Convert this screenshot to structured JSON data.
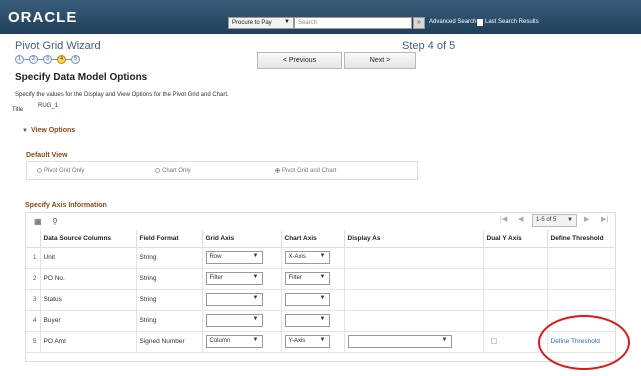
{
  "header": {
    "logo": "ORACLE",
    "scope": "Procure to Pay",
    "search_placeholder": "Search",
    "go": "»",
    "advanced_search": "Advanced Search",
    "last_search": "Last Search Results"
  },
  "wizard": {
    "title": "Pivot Grid Wizard",
    "step_label": "Step 4 of 5",
    "steps": [
      "1",
      "2",
      "3",
      "4",
      "5"
    ],
    "active_step": 4,
    "previous": "< Previous",
    "next": "Next >"
  },
  "page": {
    "title": "Specify Data Model Options",
    "intro": "Specify the values for the Display and View Options for the Pivot Grid and Chart.",
    "title_label": "Title",
    "title_value": "RUG_1"
  },
  "view_options": {
    "label": "View Options",
    "default_view": {
      "label": "Default View",
      "options": [
        "Pivot Grid Only",
        "Chart Only",
        "Pivot Grid and Chart"
      ],
      "selected": "Pivot Grid and Chart"
    }
  },
  "axis": {
    "label": "Specify Axis Information",
    "pager": {
      "first": "|◀",
      "prev": "◀",
      "range": "1-5 of 5",
      "next": "▶",
      "last": "▶|"
    },
    "columns": [
      "Data Source Columns",
      "Field Format",
      "Grid Axis",
      "Chart Axis",
      "Display As",
      "Dual Y Axis",
      "Define Threshold"
    ],
    "rows": [
      {
        "num": "1",
        "column": "Unit",
        "format": "String",
        "grid_axis": "Row",
        "chart_axis": "X-Axis",
        "display_as": "",
        "dual_y": false,
        "threshold": ""
      },
      {
        "num": "2",
        "column": "PO No.",
        "format": "String",
        "grid_axis": "Filter",
        "chart_axis": "Filter",
        "display_as": "",
        "dual_y": false,
        "threshold": ""
      },
      {
        "num": "3",
        "column": "Status",
        "format": "String",
        "grid_axis": "",
        "chart_axis": "",
        "display_as": "",
        "dual_y": false,
        "threshold": ""
      },
      {
        "num": "4",
        "column": "Buyer",
        "format": "String",
        "grid_axis": "",
        "chart_axis": "",
        "display_as": "",
        "dual_y": false,
        "threshold": ""
      },
      {
        "num": "5",
        "column": "PO Amt",
        "format": "Signed Number",
        "grid_axis": "Column",
        "chart_axis": "Y-Axis",
        "display_as": "",
        "dual_y": false,
        "threshold": "Define Threshold"
      }
    ]
  },
  "colors": {
    "header_bg": "#2b4c6b",
    "accent_orange": "#8a4a1a",
    "link": "#2a6bc2",
    "annotation": "#e0161b"
  }
}
